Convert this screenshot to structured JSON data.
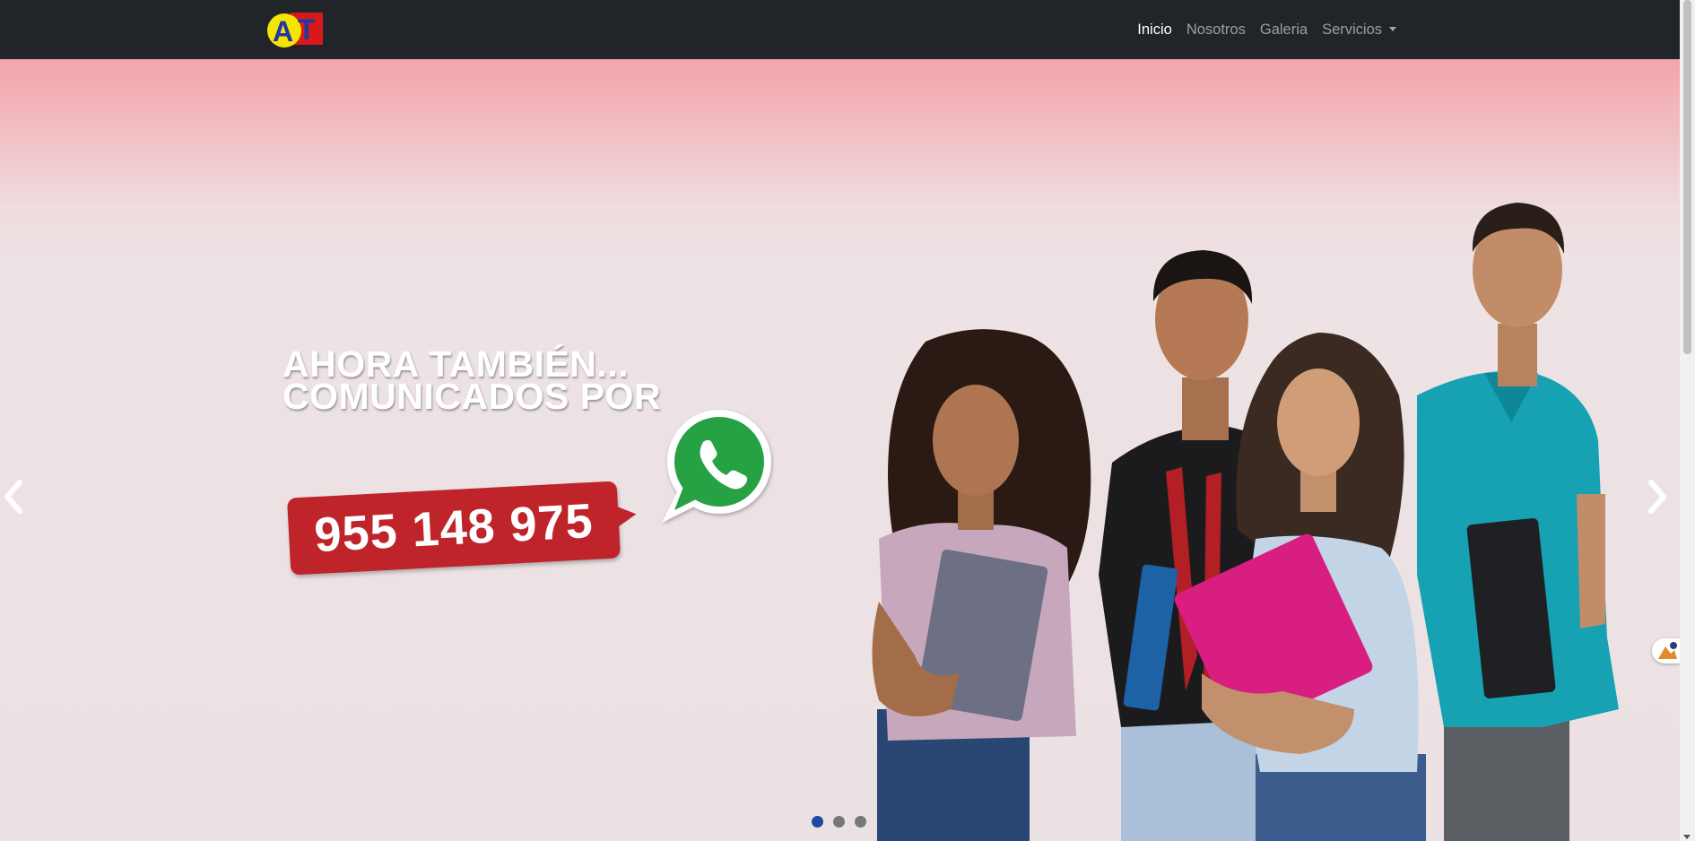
{
  "navbar": {
    "brand": {
      "letter_a": "A",
      "letter_t": "T"
    },
    "links": [
      {
        "label": "Inicio",
        "active": true
      },
      {
        "label": "Nosotros",
        "active": false
      },
      {
        "label": "Galeria",
        "active": false
      },
      {
        "label": "Servicios",
        "active": false,
        "dropdown": true
      }
    ]
  },
  "hero": {
    "headline_line1": "AHORA TAMBIÉN...",
    "headline_line2": "COMUNICADOS POR",
    "phone": "955 148 975",
    "whatsapp_icon": "whatsapp-icon",
    "carousel": {
      "prev_icon": "chevron-left-icon",
      "next_icon": "chevron-right-icon",
      "slide_count": 3,
      "active_index": 0
    }
  },
  "colors": {
    "navbar_bg": "#212529",
    "hero_top": "#f3a4ab",
    "hero_bg": "#ede3e5",
    "phone_tag": "#c0242b",
    "whatsapp_green": "#25a244",
    "indicator_active": "#1d4aa0"
  }
}
